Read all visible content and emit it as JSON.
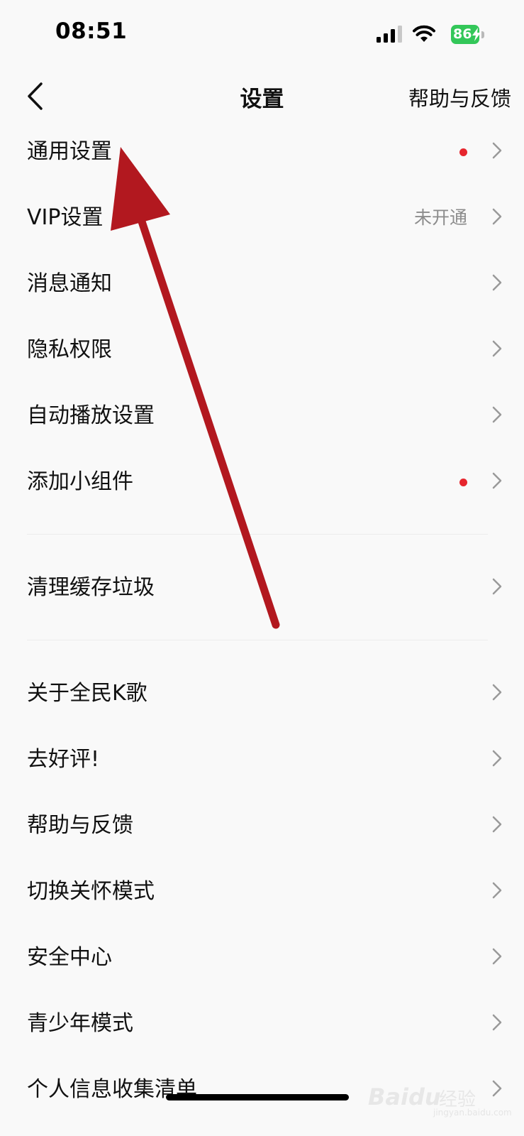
{
  "status_bar": {
    "time": "08:51",
    "battery": "86",
    "icons": [
      "signal-icon",
      "wifi-icon",
      "battery-charging-icon"
    ]
  },
  "nav": {
    "back_icon": "chevron-left-icon",
    "title": "设置",
    "help_label": "帮助与反馈"
  },
  "menu": {
    "items": [
      {
        "label": "通用设置",
        "dot": true
      },
      {
        "label": "VIP设置",
        "value": "未开通"
      },
      {
        "label": "消息通知"
      },
      {
        "label": "隐私权限"
      },
      {
        "label": "自动播放设置"
      },
      {
        "label": "添加小组件",
        "dot": true
      },
      {
        "label": "清理缓存垃圾"
      },
      {
        "label": "关于全民K歌"
      },
      {
        "label": "去好评!"
      },
      {
        "label": "帮助与反馈"
      },
      {
        "label": "切换关怀模式"
      },
      {
        "label": "安全中心"
      },
      {
        "label": "青少年模式"
      },
      {
        "label": "个人信息收集清单"
      }
    ]
  },
  "colors": {
    "dot": "#e6262e",
    "battery": "#33c759",
    "annotation_arrow": "#b2181f"
  },
  "watermark": {
    "brand": "Baidu",
    "suffix": "经验",
    "url": "jingyan.baidu.com"
  }
}
